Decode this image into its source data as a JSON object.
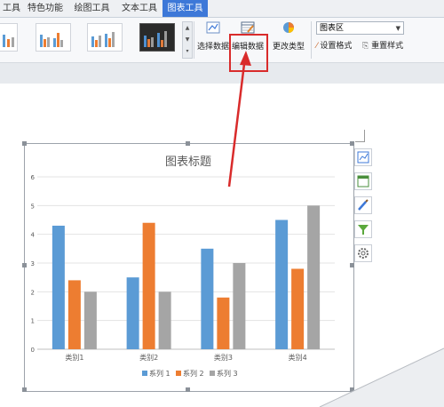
{
  "tabs": [
    {
      "label": "工具",
      "active": false
    },
    {
      "label": "特色功能",
      "active": false
    },
    {
      "label": "绘图工具",
      "active": false
    },
    {
      "label": "文本工具",
      "active": false
    },
    {
      "label": "图表工具",
      "active": true
    }
  ],
  "ribbon": {
    "select_data": "选择数据",
    "edit_data": "编辑数据",
    "change_type": "更改类型",
    "element_dropdown": "图表区",
    "set_format": "设置格式",
    "reset_style": "重置样式"
  },
  "chart_data": {
    "type": "bar",
    "title": "图表标题",
    "categories": [
      "类别1",
      "类别2",
      "类别3",
      "类别4"
    ],
    "series": [
      {
        "name": "系列 1",
        "values": [
          4.3,
          2.5,
          3.5,
          4.5
        ],
        "color": "#5b9bd5"
      },
      {
        "name": "系列 2",
        "values": [
          2.4,
          4.4,
          1.8,
          2.8
        ],
        "color": "#ed7d31"
      },
      {
        "name": "系列 3",
        "values": [
          2,
          2,
          3,
          5
        ],
        "color": "#a5a5a5"
      }
    ],
    "ylim": [
      0,
      6
    ],
    "yticks": [
      "0",
      "1",
      "2",
      "3",
      "4",
      "5",
      "6"
    ],
    "grid": true,
    "legend": "bottom"
  },
  "colors": {
    "accent": "#3d78d8",
    "highlight": "#d92b2b"
  }
}
